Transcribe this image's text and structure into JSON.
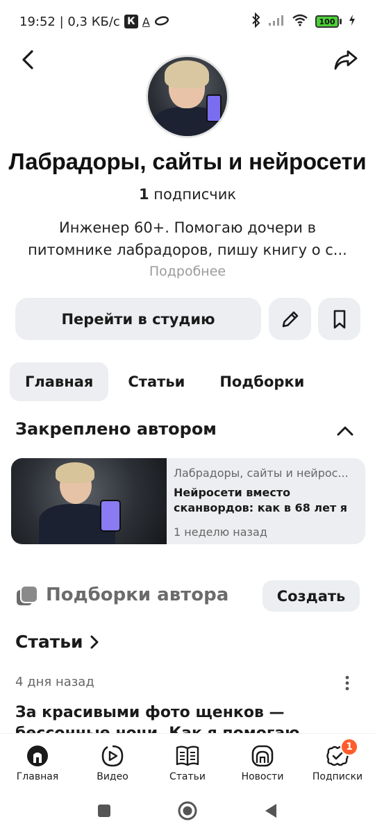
{
  "status_bar": {
    "time_speed": "19:52 | 0,3 КБ/с",
    "k_badge": "К",
    "battery": "100"
  },
  "header": {
    "back_icon": "chevron-left-icon",
    "share_icon": "share-icon"
  },
  "channel": {
    "title": "Лабрадоры, сайты и нейросети",
    "subscribers_count": "1",
    "subscribers_label": " подписчик",
    "description": "Инженер 60+. Помогаю дочери в питомнике лабрадоров, пишу книгу о с...",
    "more_label": "Подробнее"
  },
  "actions": {
    "studio_label": "Перейти в студию",
    "edit_icon": "pencil-icon",
    "bookmark_icon": "bookmark-icon"
  },
  "tabs": [
    {
      "label": "Главная",
      "active": true
    },
    {
      "label": "Статьи",
      "active": false
    },
    {
      "label": "Подборки",
      "active": false
    }
  ],
  "pinned": {
    "section_title": "Закреплено автором",
    "card": {
      "channel": "Лабрадоры, сайты и нейрос...",
      "headline": "Нейросети вместо сканвордов: как в 68 лет я п...",
      "date": "1 неделю назад"
    }
  },
  "collections": {
    "title": "Подборки автора",
    "create_label": "Создать"
  },
  "articles": {
    "title": "Статьи",
    "first": {
      "date": "4 дня назад",
      "title": "За красивыми фото щенков — бессонные ночи. Как я помогаю дочери"
    }
  },
  "bottom_nav": [
    {
      "label": "Главная",
      "icon": "home-icon"
    },
    {
      "label": "Видео",
      "icon": "video-icon"
    },
    {
      "label": "Статьи",
      "icon": "articles-icon"
    },
    {
      "label": "Новости",
      "icon": "news-icon"
    },
    {
      "label": "Подписки",
      "icon": "subscriptions-icon",
      "badge": "1"
    }
  ],
  "colors": {
    "accent_badge": "#ff5b2b",
    "button_bg": "#eceef1",
    "battery": "#4cd137"
  }
}
